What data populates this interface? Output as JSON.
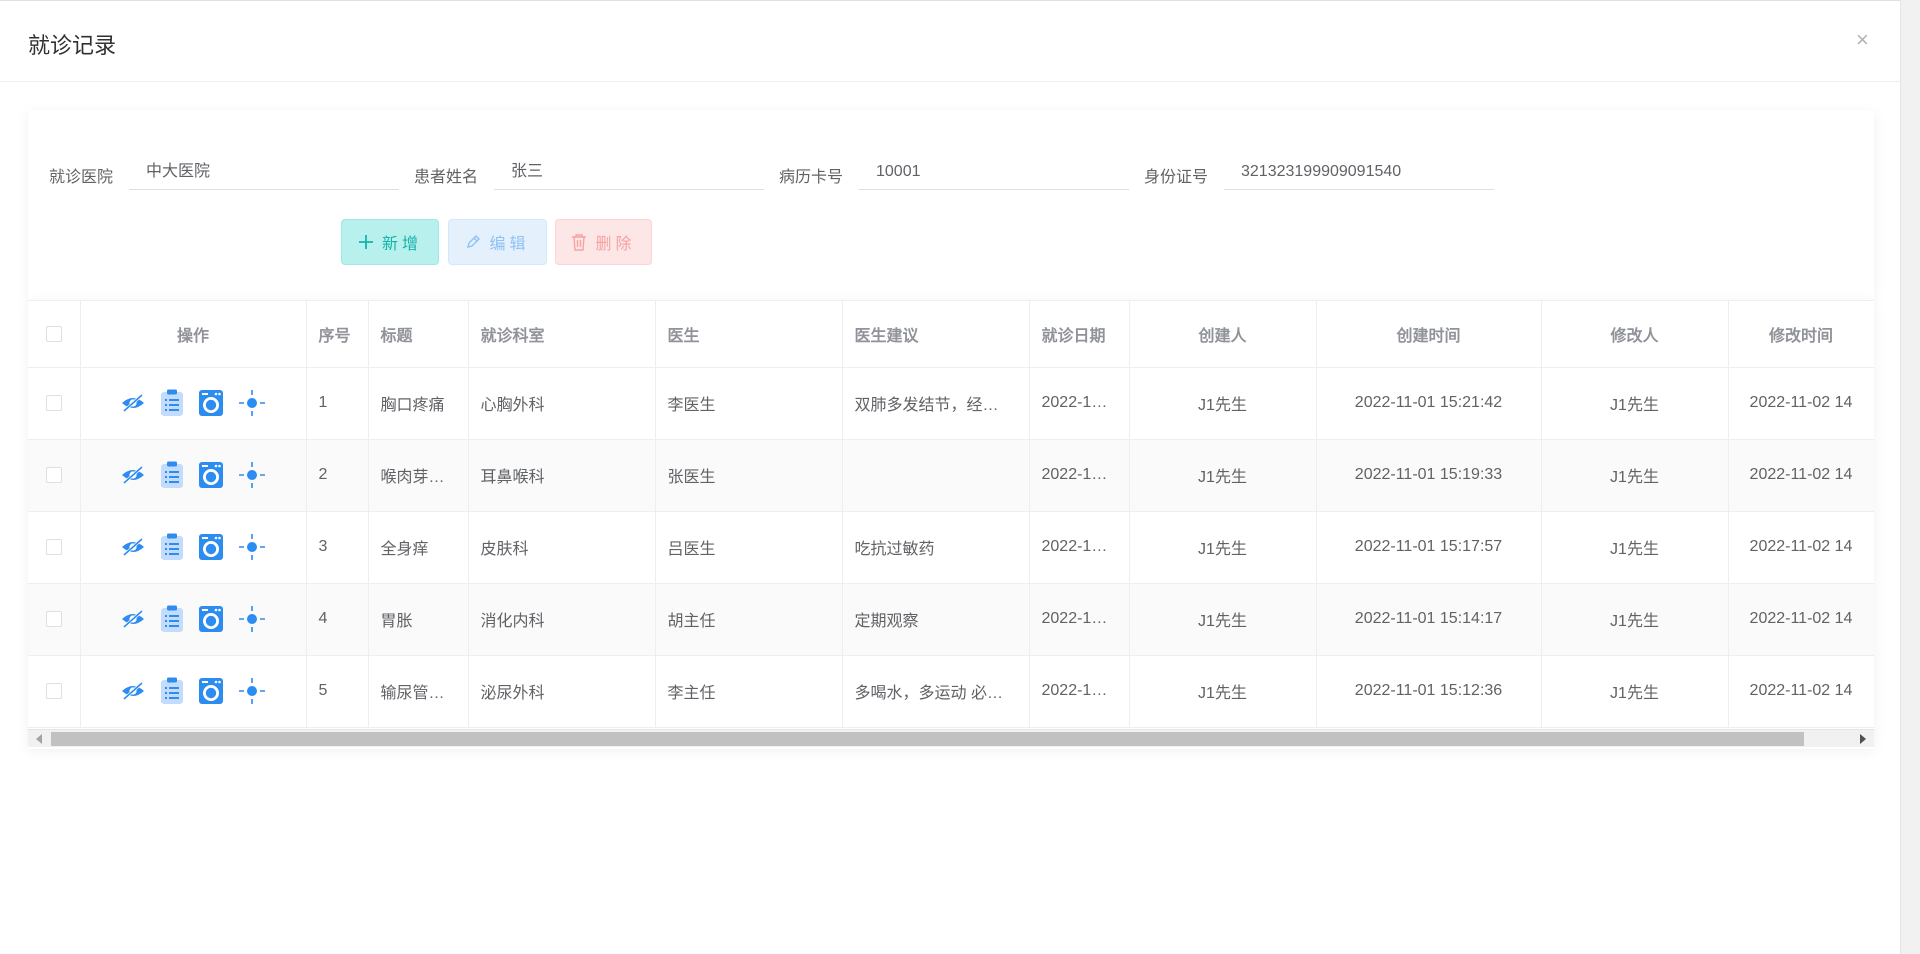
{
  "dialog": {
    "title": "就诊记录",
    "close_symbol": "×"
  },
  "search": {
    "fields": [
      {
        "label": "就诊医院",
        "value": "中大医院"
      },
      {
        "label": "患者姓名",
        "value": "张三"
      },
      {
        "label": "病历卡号",
        "value": "10001"
      },
      {
        "label": "身份证号",
        "value": "321323199909091540"
      }
    ]
  },
  "toolbar": {
    "add_label": "新增",
    "edit_label": "编辑",
    "delete_label": "删除"
  },
  "table": {
    "headers": [
      "操作",
      "序号",
      "标题",
      "就诊科室",
      "医生",
      "医生建议",
      "就诊日期",
      "创建人",
      "创建时间",
      "修改人",
      "修改时间"
    ],
    "rows": [
      {
        "no": "1",
        "title": "胸口疼痛",
        "dept": "心胸外科",
        "doctor": "李医生",
        "advice": "双肺多发结节，经…",
        "date": "2022-1…",
        "creator": "J1先生",
        "created": "2022-11-01 15:21:42",
        "modifier": "J1先生",
        "modified": "2022-11-02 14"
      },
      {
        "no": "2",
        "title": "喉肉芽…",
        "dept": "耳鼻喉科",
        "doctor": "张医生",
        "advice": "",
        "date": "2022-1…",
        "creator": "J1先生",
        "created": "2022-11-01 15:19:33",
        "modifier": "J1先生",
        "modified": "2022-11-02 14"
      },
      {
        "no": "3",
        "title": "全身痒",
        "dept": "皮肤科",
        "doctor": "吕医生",
        "advice": "吃抗过敏药",
        "date": "2022-1…",
        "creator": "J1先生",
        "created": "2022-11-01 15:17:57",
        "modifier": "J1先生",
        "modified": "2022-11-02 14"
      },
      {
        "no": "4",
        "title": "胃胀",
        "dept": "消化内科",
        "doctor": "胡主任",
        "advice": "定期观察",
        "date": "2022-1…",
        "creator": "J1先生",
        "created": "2022-11-01 15:14:17",
        "modifier": "J1先生",
        "modified": "2022-11-02 14"
      },
      {
        "no": "5",
        "title": "输尿管…",
        "dept": "泌尿外科",
        "doctor": "李主任",
        "advice": "多喝水，多运动 必…",
        "date": "2022-1…",
        "creator": "J1先生",
        "created": "2022-11-01 15:12:36",
        "modifier": "J1先生",
        "modified": "2022-11-02 14"
      }
    ]
  },
  "icons": {
    "op_icons": [
      "eye-slash-icon",
      "clipboard-list-icon",
      "washer-icon",
      "sun-icon"
    ],
    "accent": "#2d8cf0",
    "add": "#17b2aa",
    "edit": "#8fc1f3",
    "delete": "#f6a2a2"
  }
}
